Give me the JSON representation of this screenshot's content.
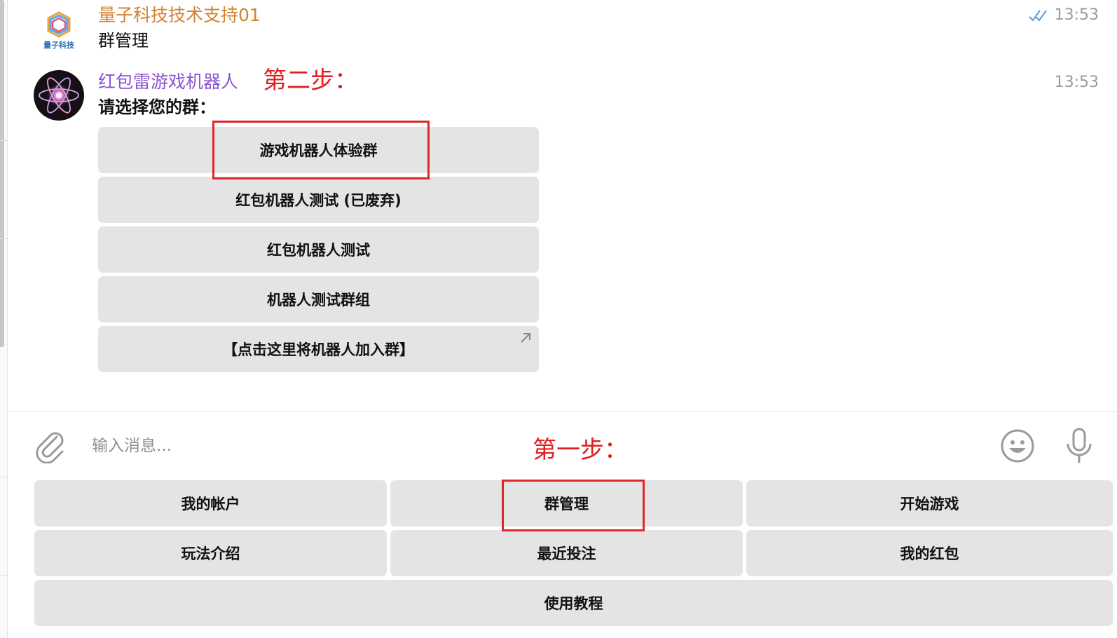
{
  "messages": [
    {
      "sender": "量子科技技术支持01",
      "text": "群管理",
      "time": "13:53",
      "avatar_label": "量子科技",
      "read_status": "double-check"
    },
    {
      "sender": "红包雷游戏机器人",
      "text": "请选择您的群：",
      "time": "13:53"
    }
  ],
  "annotations": {
    "step_two": "第二步：",
    "step_one": "第一步："
  },
  "inline_keyboard": [
    "游戏机器人体验群",
    "红包机器人测试 (已废弃)",
    "红包机器人测试",
    "机器人测试群组",
    "【点击这里将机器人加入群】"
  ],
  "composer": {
    "placeholder": "输入消息..."
  },
  "reply_keyboard": [
    [
      "我的帐户",
      "群管理",
      "开始游戏"
    ],
    [
      "玩法介绍",
      "最近投注",
      "我的红包"
    ],
    [
      "使用教程"
    ]
  ],
  "colors": {
    "annotation": "#e02020",
    "sender_support": "#d18331",
    "sender_bot": "#8c52d1",
    "button_bg": "#e4e4e4",
    "read_check": "#5b9bd5"
  },
  "icons": [
    "attach-clip-icon",
    "emoji-icon",
    "microphone-icon",
    "external-link-arrow-icon",
    "read-double-check-icon"
  ]
}
